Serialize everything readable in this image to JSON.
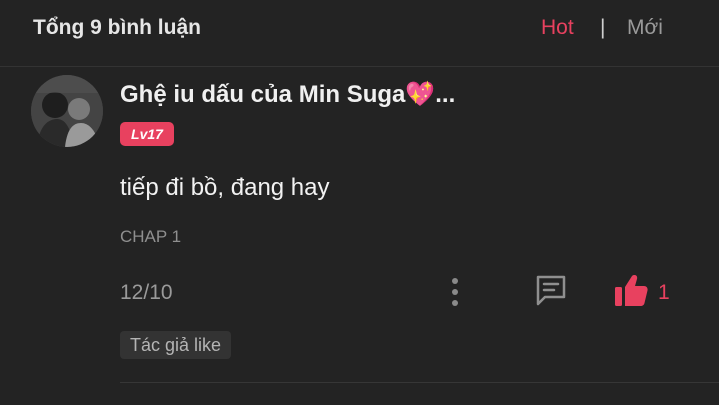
{
  "header": {
    "total_label": "Tổng 9 bình luận",
    "sort_hot": "Hot",
    "sort_separator": "|",
    "sort_new": "Mới",
    "accent_color": "#e8415f"
  },
  "comment": {
    "avatar_icon": "avatar-photo",
    "username": "Ghệ iu dấu của Min Suga💖...",
    "level": "Lv17",
    "text": "tiếp đi bồ, đang hay",
    "chapter": "CHAP 1",
    "date": "12/10",
    "like_count": "1",
    "author_like_badge": "Tác giả like",
    "icons": [
      "more-vertical-icon",
      "reply-icon",
      "thumbs-up-icon"
    ]
  }
}
